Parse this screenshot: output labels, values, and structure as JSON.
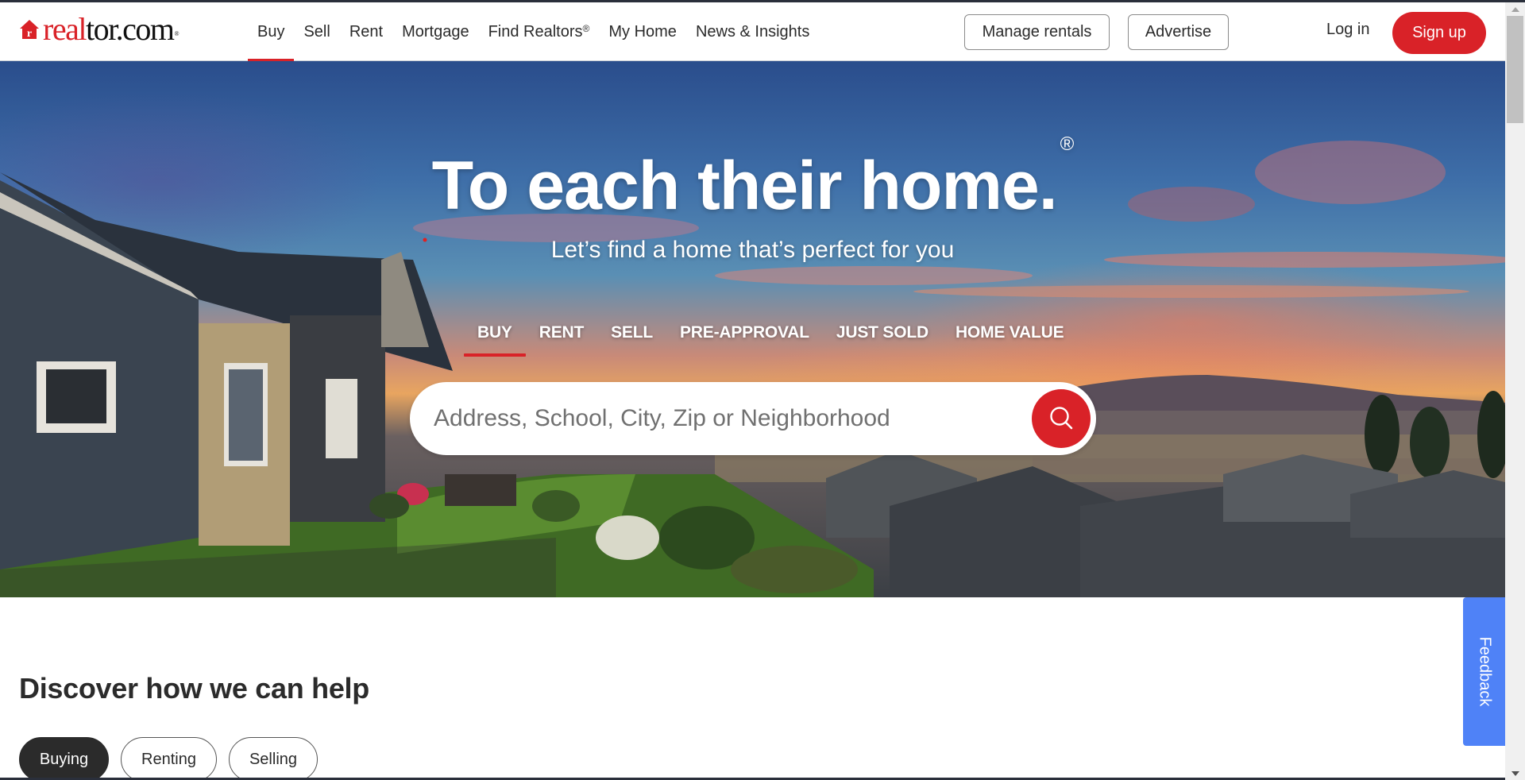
{
  "brand": {
    "logo_red": "real",
    "logo_black": "tor.com",
    "logo_mark": "®",
    "brand_color": "#d92228"
  },
  "nav": {
    "items": [
      {
        "label": "Buy",
        "active": true
      },
      {
        "label": "Sell"
      },
      {
        "label": "Rent"
      },
      {
        "label": "Mortgage"
      },
      {
        "label": "Find Realtors",
        "sup": "®"
      },
      {
        "label": "My Home"
      },
      {
        "label": "News & Insights"
      }
    ],
    "manage_rentals": "Manage rentals",
    "advertise": "Advertise",
    "login": "Log in",
    "signup": "Sign up"
  },
  "hero": {
    "title": "To each their home.",
    "title_mark": "®",
    "subtitle": "Let’s find a home that’s perfect for you",
    "tabs": [
      {
        "label": "BUY",
        "active": true
      },
      {
        "label": "RENT"
      },
      {
        "label": "SELL"
      },
      {
        "label": "PRE-APPROVAL"
      },
      {
        "label": "JUST SOLD"
      },
      {
        "label": "HOME VALUE"
      }
    ],
    "search": {
      "placeholder": "Address, School, City, Zip or Neighborhood",
      "value": "",
      "button_icon": "search-icon"
    }
  },
  "discover": {
    "title": "Discover how we can help",
    "pills": [
      {
        "label": "Buying",
        "active": true
      },
      {
        "label": "Renting"
      },
      {
        "label": "Selling"
      }
    ]
  },
  "feedback": {
    "label": "Feedback",
    "color": "#4f82f7"
  }
}
